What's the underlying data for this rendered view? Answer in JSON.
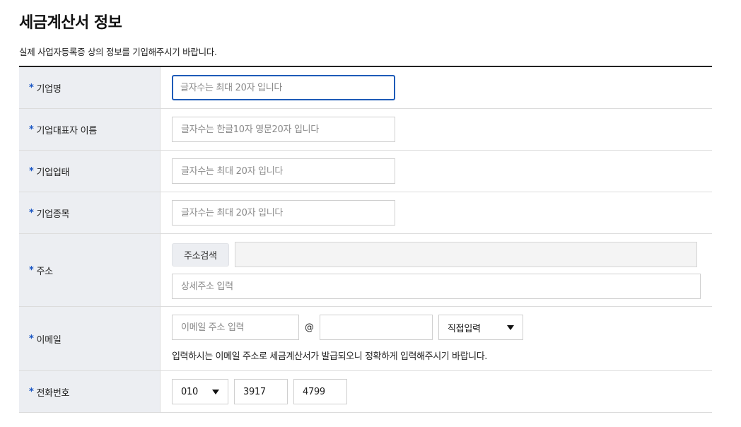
{
  "title": "세금계산서 정보",
  "description": "실제 사업자등록증 상의 정보를 기입해주시기 바랍니다.",
  "required_mark": "*",
  "fields": {
    "company_name": {
      "label": "기업명",
      "placeholder": "글자수는 최대 20자 입니다",
      "value": ""
    },
    "ceo_name": {
      "label": "기업대표자 이름",
      "placeholder": "글자수는 한글10자 영문20자 입니다",
      "value": ""
    },
    "business_type": {
      "label": "기업업태",
      "placeholder": "글자수는 최대 20자 입니다",
      "value": ""
    },
    "business_category": {
      "label": "기업종목",
      "placeholder": "글자수는 최대 20자 입니다",
      "value": ""
    },
    "address": {
      "label": "주소",
      "search_button": "주소검색",
      "detail_placeholder": "상세주소 입력",
      "value": ""
    },
    "email": {
      "label": "이메일",
      "local_placeholder": "이메일 주소 입력",
      "at": "@",
      "domain_value": "",
      "domain_select": "직접입력",
      "note": "입력하시는 이메일 주소로 세금계산서가 발급되오니 정확하게 입력해주시기 바랍니다."
    },
    "phone": {
      "label": "전화번호",
      "prefix": "010",
      "middle": "3917",
      "last": "4799"
    }
  }
}
